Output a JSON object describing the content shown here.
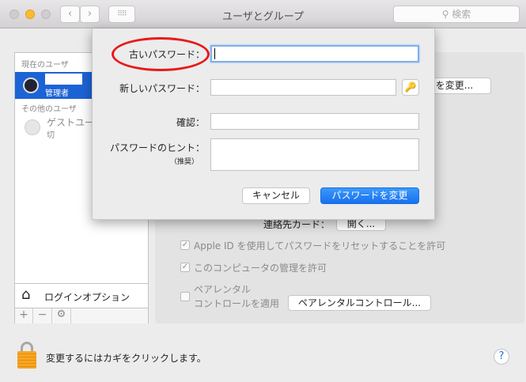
{
  "window": {
    "title": "ユーザとグループ",
    "search_placeholder": "検索"
  },
  "sidebar": {
    "current_users_header": "現在のユーザ",
    "current_user": {
      "name": "",
      "role": "管理者"
    },
    "other_users_header": "その他のユーザ",
    "guest": {
      "name": "ゲストユー",
      "status": "切"
    },
    "login_options": "ログインオプション"
  },
  "panel": {
    "change_password_button": "ドを変更...",
    "contact_card_label": "連絡先カード：",
    "contact_card_button": "開く...",
    "apple_id_reset": {
      "label": "Apple ID を使用してパスワードをリセットすることを許可",
      "checked": true
    },
    "admin": {
      "label": "このコンピュータの管理を許可",
      "checked": true
    },
    "parental": {
      "label_line1": "ペアレンタル",
      "label_line2": "コントロールを適用",
      "checked": false,
      "button": "ペアレンタルコントロール..."
    }
  },
  "sheet": {
    "old_password_label": "古いパスワード：",
    "new_password_label": "新しいパスワード：",
    "verify_label": "確認：",
    "hint_label": "パスワードのヒント：",
    "hint_sublabel": "（推奨）",
    "old_password": "",
    "new_password": "",
    "verify": "",
    "hint": "",
    "cancel": "キャンセル",
    "change_password": "パスワードを変更"
  },
  "footer": {
    "lock_text": "変更するにはカギをクリックします。",
    "help": "?"
  },
  "colors": {
    "accent": "#1c63d5",
    "highlight_ellipse": "#e8191a"
  }
}
